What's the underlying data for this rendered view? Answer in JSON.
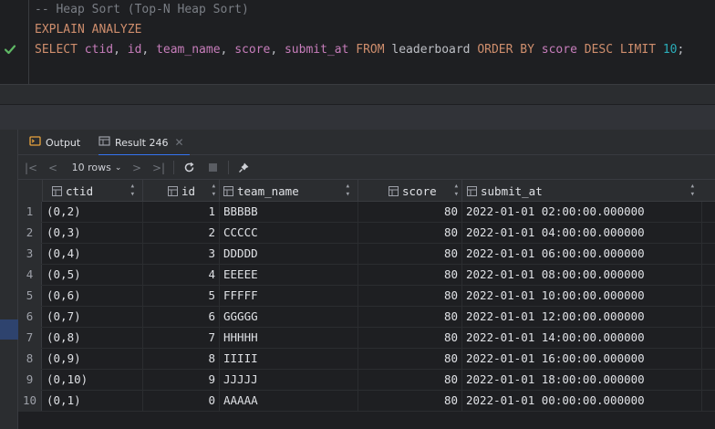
{
  "editor": {
    "line1": "-- Heap Sort (Top-N Heap Sort)",
    "line2": "EXPLAIN ANALYZE",
    "line3": {
      "select": "SELECT",
      "cols": [
        "ctid",
        "id",
        "team_name",
        "score",
        "submit_at"
      ],
      "from": "FROM",
      "table": "leaderboard",
      "order_by": "ORDER BY",
      "order_col": "score",
      "desc": "DESC",
      "limit": "LIMIT",
      "limit_val": "10",
      "end": ";"
    },
    "status_icon": "check-icon"
  },
  "tabs": [
    {
      "label": "Output",
      "icon": "output-icon"
    },
    {
      "label": "Result 246",
      "icon": "table-icon",
      "active": true
    }
  ],
  "toolbar": {
    "rows_label": "10 rows"
  },
  "grid": {
    "columns": [
      "ctid",
      "id",
      "team_name",
      "score",
      "submit_at"
    ],
    "rows": [
      {
        "n": "1",
        "ctid": "(0,2)",
        "id": "1",
        "team_name": "BBBBB",
        "score": "80",
        "submit_at": "2022-01-01 02:00:00.000000"
      },
      {
        "n": "2",
        "ctid": "(0,3)",
        "id": "2",
        "team_name": "CCCCC",
        "score": "80",
        "submit_at": "2022-01-01 04:00:00.000000"
      },
      {
        "n": "3",
        "ctid": "(0,4)",
        "id": "3",
        "team_name": "DDDDD",
        "score": "80",
        "submit_at": "2022-01-01 06:00:00.000000"
      },
      {
        "n": "4",
        "ctid": "(0,5)",
        "id": "4",
        "team_name": "EEEEE",
        "score": "80",
        "submit_at": "2022-01-01 08:00:00.000000"
      },
      {
        "n": "5",
        "ctid": "(0,6)",
        "id": "5",
        "team_name": "FFFFF",
        "score": "80",
        "submit_at": "2022-01-01 10:00:00.000000"
      },
      {
        "n": "6",
        "ctid": "(0,7)",
        "id": "6",
        "team_name": "GGGGG",
        "score": "80",
        "submit_at": "2022-01-01 12:00:00.000000"
      },
      {
        "n": "7",
        "ctid": "(0,8)",
        "id": "7",
        "team_name": "HHHHH",
        "score": "80",
        "submit_at": "2022-01-01 14:00:00.000000"
      },
      {
        "n": "8",
        "ctid": "(0,9)",
        "id": "8",
        "team_name": "IIIII",
        "score": "80",
        "submit_at": "2022-01-01 16:00:00.000000"
      },
      {
        "n": "9",
        "ctid": "(0,10)",
        "id": "9",
        "team_name": "JJJJJ",
        "score": "80",
        "submit_at": "2022-01-01 18:00:00.000000"
      },
      {
        "n": "10",
        "ctid": "(0,1)",
        "id": "0",
        "team_name": "AAAAA",
        "score": "80",
        "submit_at": "2022-01-01 00:00:00.000000"
      }
    ]
  },
  "colors": {
    "keyword": "#cf8e6d",
    "identifier": "#c77dbb",
    "comment": "#7a7e85",
    "number": "#2aacb8",
    "success": "#5fb865",
    "accent": "#3574f0"
  }
}
